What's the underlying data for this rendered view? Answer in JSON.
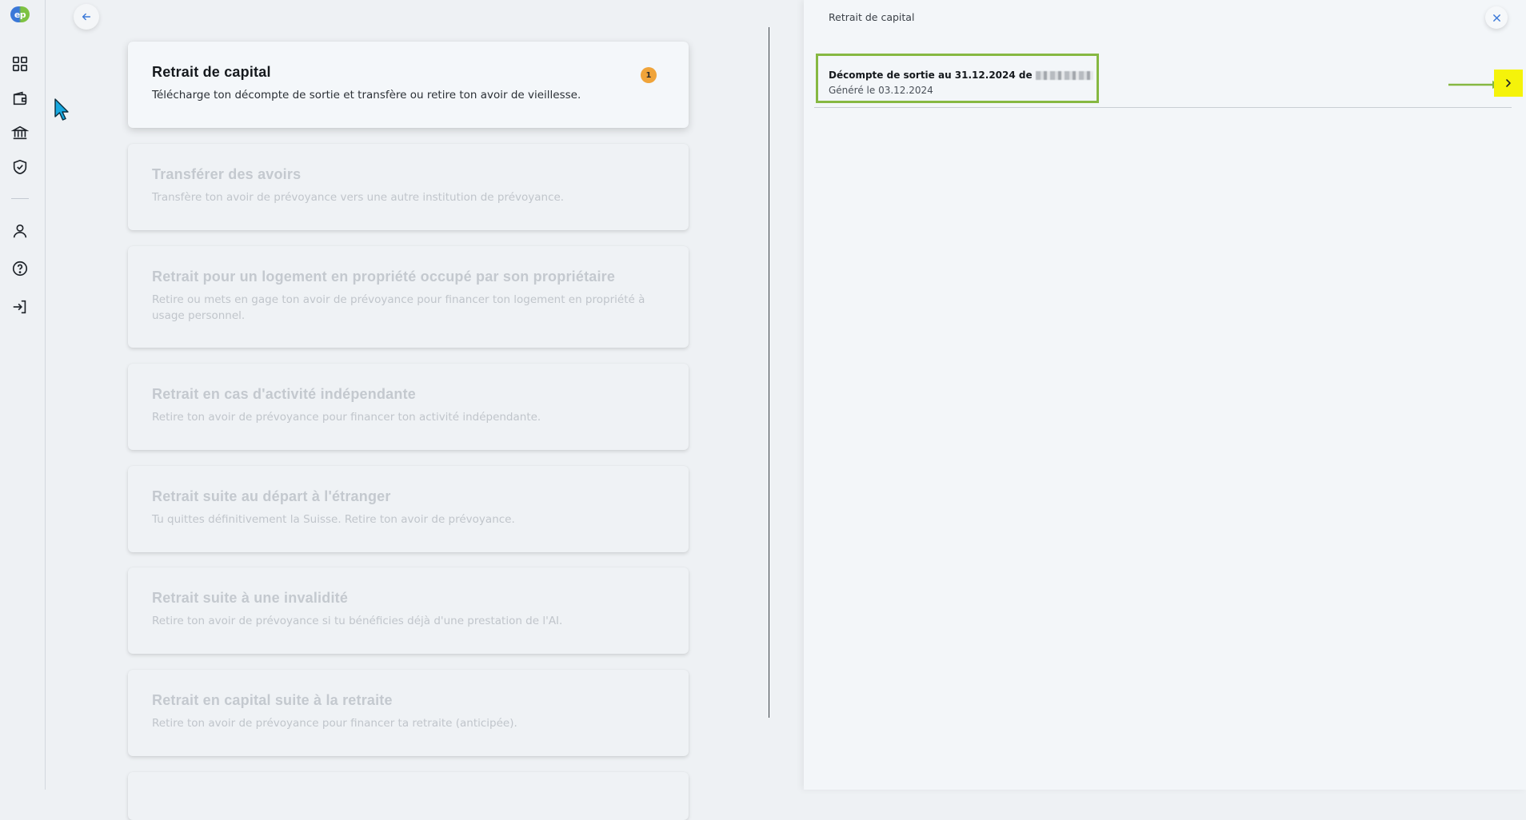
{
  "rail": {
    "logo_text": "ep",
    "items": [
      {
        "name": "dashboard-icon"
      },
      {
        "name": "wallet-icon"
      },
      {
        "name": "bank-icon"
      },
      {
        "name": "shield-check-icon"
      },
      {
        "name": "user-icon"
      },
      {
        "name": "help-icon"
      },
      {
        "name": "logout-icon"
      }
    ]
  },
  "cards": [
    {
      "title": "Retrait de capital",
      "description": "Télécharge ton décompte de sortie et transfère ou retire ton avoir de vieillesse.",
      "badge": "1",
      "active": true
    },
    {
      "title": "Transférer des avoirs",
      "description": "Transfère ton avoir de prévoyance vers une autre institution de prévoyance.",
      "active": false
    },
    {
      "title": "Retrait pour un logement en propriété occupé par son propriétaire",
      "description": "Retire ou mets en gage ton avoir de prévoyance pour financer ton logement en propriété à usage personnel.",
      "active": false
    },
    {
      "title": "Retrait en cas d'activité indépendante",
      "description": "Retire ton avoir de prévoyance pour financer ton activité indépendante.",
      "active": false
    },
    {
      "title": "Retrait suite au départ à l'étranger",
      "description": "Tu quittes définitivement la Suisse. Retire ton avoir de prévoyance.",
      "active": false
    },
    {
      "title": "Retrait suite à une invalidité",
      "description": "Retire ton avoir de prévoyance si tu bénéficies déjà d'une prestation de l'AI.",
      "active": false
    },
    {
      "title": "Retrait en capital suite à la retraite",
      "description": "Retire ton avoir de prévoyance pour financer ta retraite (anticipée).",
      "active": false
    }
  ],
  "panel": {
    "title": "Retrait de capital",
    "document": {
      "title": "Décompte de sortie au 31.12.2024 de",
      "date": "Généré le 03.12.2024"
    }
  },
  "colors": {
    "badge": "#f0a43a",
    "highlight_border": "#86b842",
    "chevron_highlight": "#f5f30a",
    "accent_blue": "#3a78d8"
  }
}
